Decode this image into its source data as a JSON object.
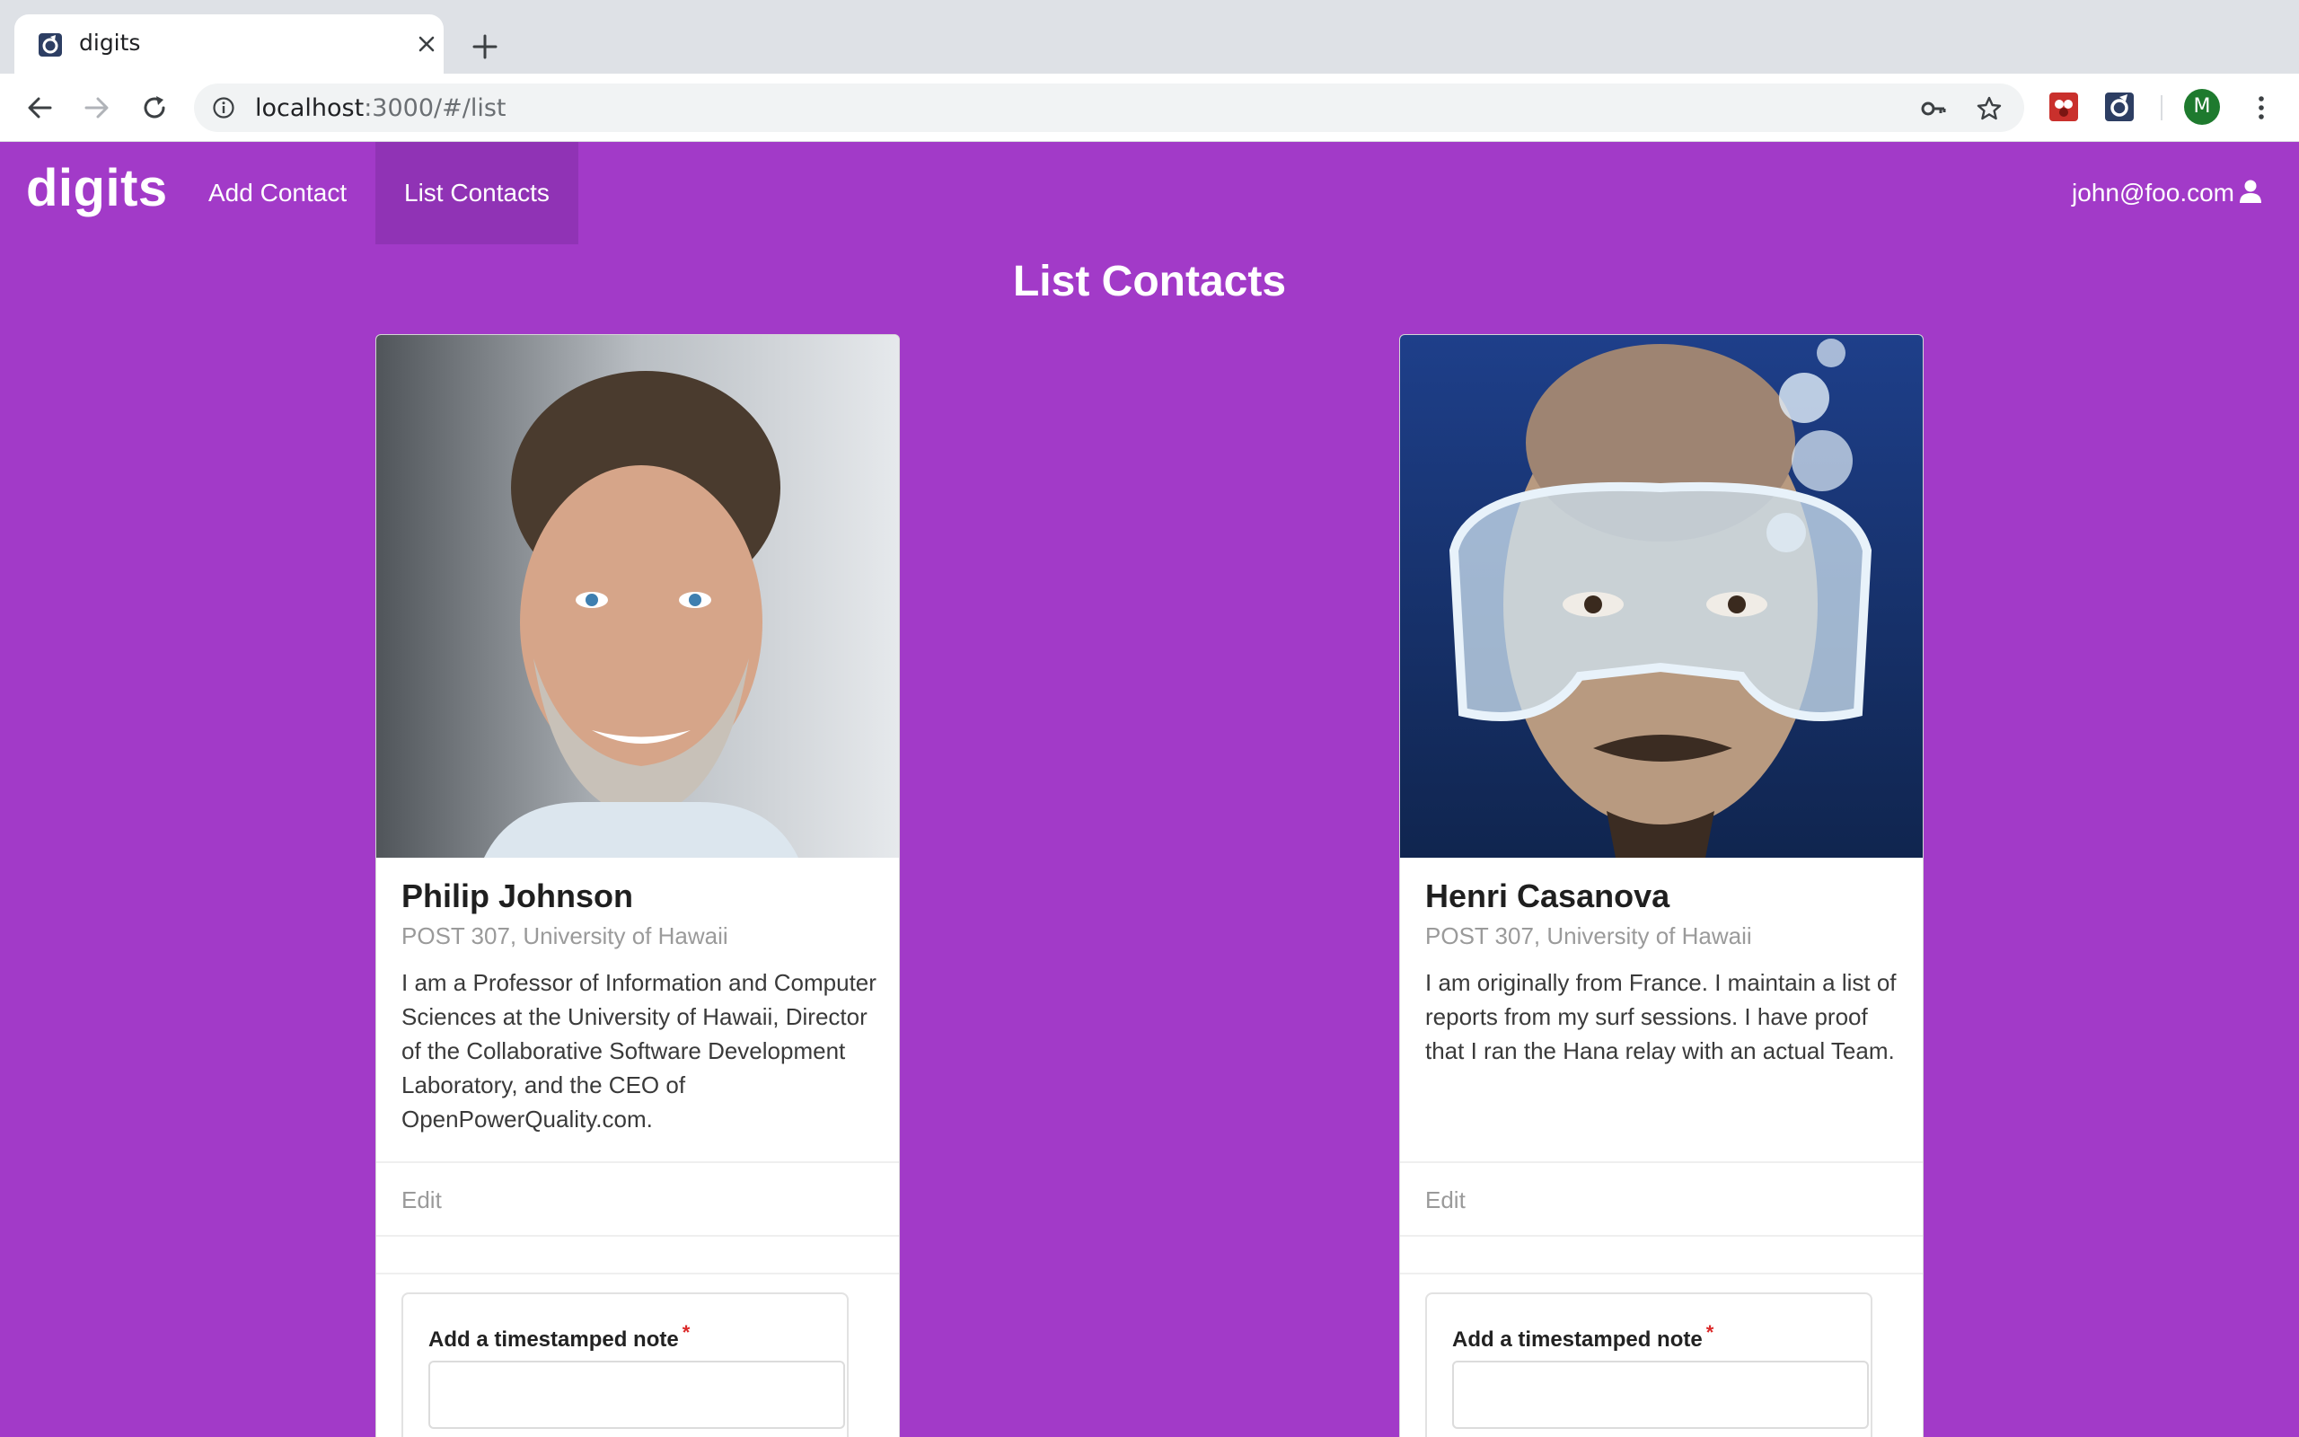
{
  "browser": {
    "tab_title": "digits",
    "url_host": "localhost",
    "url_rest": ":3000/#/list",
    "profile_initial": "M"
  },
  "nav": {
    "brand": "digits",
    "links": [
      {
        "label": "Add Contact",
        "active": false
      },
      {
        "label": "List Contacts",
        "active": true
      }
    ],
    "user": "john@foo.com"
  },
  "page": {
    "title": "List Contacts"
  },
  "contacts": [
    {
      "name": "Philip Johnson",
      "address": "POST 307, University of Hawaii",
      "description": "I am a Professor of Information and Computer Sciences at the University of Hawaii, Director of the Collaborative Software Development Laboratory, and the CEO of OpenPowerQuality.com.",
      "edit_label": "Edit",
      "note_label": "Add a timestamped note",
      "required_mark": "*"
    },
    {
      "name": "Henri Casanova",
      "address": "POST 307, University of Hawaii",
      "description": "I am originally from France. I maintain a list of reports from my surf sessions. I have proof that I ran the Hana relay with an actual Team.",
      "edit_label": "Edit",
      "note_label": "Add a timestamped note",
      "required_mark": "*"
    }
  ],
  "colors": {
    "brand_bg": "#a23ac8",
    "active_nav_bg": "#9033b5",
    "required": "#db2828"
  }
}
